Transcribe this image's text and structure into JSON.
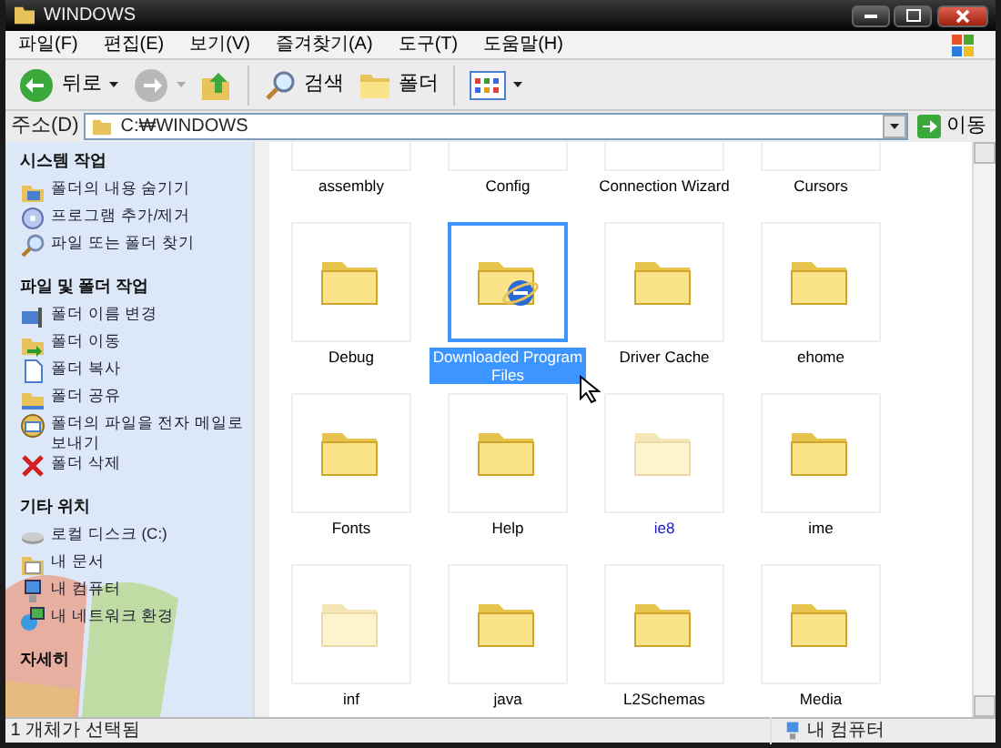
{
  "window": {
    "title": "WINDOWS"
  },
  "menu": [
    "파일(F)",
    "편집(E)",
    "보기(V)",
    "즐겨찾기(A)",
    "도구(T)",
    "도움말(H)"
  ],
  "toolbar": [
    {
      "kind": "back",
      "label": "뒤로",
      "disabled": false
    },
    {
      "kind": "forward",
      "disabled": true
    },
    {
      "kind": "up"
    },
    {
      "kind": "search",
      "label": "검색"
    },
    {
      "kind": "folders",
      "label": "폴더"
    },
    {
      "kind": "views"
    }
  ],
  "address": {
    "label": "주소(D)",
    "value": "C:₩WINDOWS",
    "go": "이동"
  },
  "sidebar": [
    {
      "title": "시스템 작업",
      "items": [
        {
          "kind": "folder-view",
          "label": "폴더의 내용 숨기기"
        },
        {
          "kind": "add-remove",
          "label": "프로그램 추가/제거"
        },
        {
          "kind": "search",
          "label": "파일 또는 폴더 찾기"
        }
      ]
    },
    {
      "title": "파일 및 폴더 작업",
      "items": [
        {
          "kind": "rename",
          "label": "폴더 이름 변경"
        },
        {
          "kind": "move",
          "label": "폴더 이동"
        },
        {
          "kind": "copy",
          "label": "폴더 복사"
        },
        {
          "kind": "share",
          "label": "폴더 공유"
        },
        {
          "kind": "email",
          "label": "폴더의 파일을 전자 메일로 보내기"
        },
        {
          "kind": "delete",
          "label": "폴더 삭제"
        }
      ]
    },
    {
      "title": "기타 위치",
      "items": [
        {
          "kind": "disk",
          "label": "로컬 디스크 (C:)"
        },
        {
          "kind": "documents",
          "label": "내 문서"
        },
        {
          "kind": "computer",
          "label": "내 컴퓨터"
        },
        {
          "kind": "network",
          "label": "내 네트워크 환경"
        }
      ]
    },
    {
      "title": "자세히"
    }
  ],
  "folders": [
    {
      "name": "assembly",
      "selected": false,
      "compressed": false
    },
    {
      "name": "Config",
      "selected": false,
      "compressed": false
    },
    {
      "name": "Connection Wizard",
      "selected": false,
      "compressed": false
    },
    {
      "name": "Cursors",
      "selected": false,
      "compressed": false
    },
    {
      "name": "Debug",
      "kind": "folder",
      "selected": false,
      "hidden": false,
      "compressed": false
    },
    {
      "name": "Downloaded Program Files",
      "kind": "ie-folder",
      "selected": true,
      "hidden": false,
      "compressed": false
    },
    {
      "name": "Driver Cache",
      "kind": "folder",
      "selected": false,
      "hidden": false,
      "compressed": false
    },
    {
      "name": "ehome",
      "kind": "folder",
      "selected": false,
      "hidden": false,
      "compressed": false
    },
    {
      "name": "Fonts",
      "kind": "folder",
      "selected": false,
      "hidden": false,
      "compressed": false
    },
    {
      "name": "Help",
      "kind": "folder",
      "selected": false,
      "hidden": false,
      "compressed": false
    },
    {
      "name": "ie8",
      "kind": "folder",
      "selected": false,
      "hidden": true,
      "compressed": true
    },
    {
      "name": "ime",
      "kind": "folder",
      "selected": false,
      "hidden": false,
      "compressed": false
    },
    {
      "name": "inf",
      "kind": "folder",
      "selected": false,
      "hidden": true,
      "compressed": false
    },
    {
      "name": "java",
      "kind": "folder",
      "selected": false,
      "hidden": false,
      "compressed": false
    },
    {
      "name": "L2Schemas",
      "kind": "folder",
      "selected": false,
      "hidden": false,
      "compressed": false
    },
    {
      "name": "Media",
      "kind": "folder",
      "selected": false,
      "hidden": false,
      "compressed": false
    }
  ],
  "status_bar": {
    "text": "1 개체가 선택됨",
    "location": "내 컴퓨터"
  }
}
